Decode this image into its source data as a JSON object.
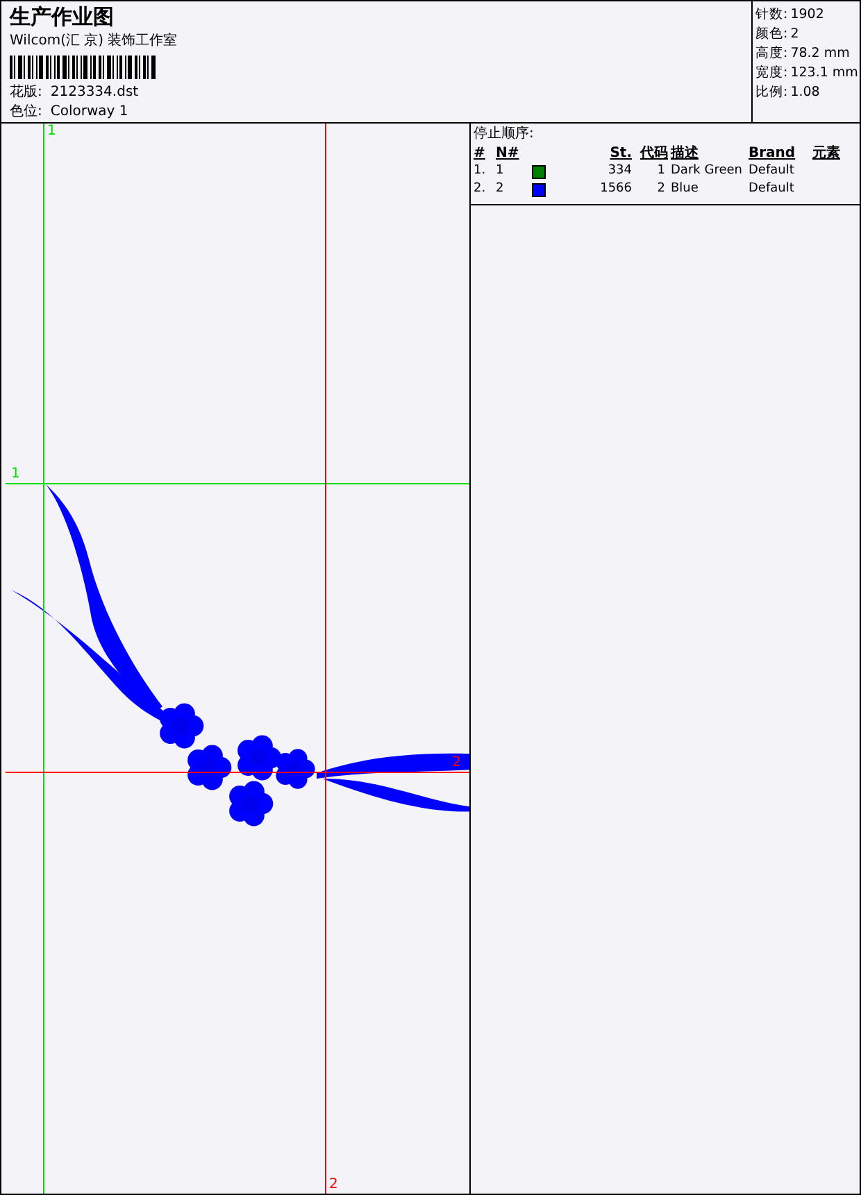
{
  "header": {
    "title": "生产作业图",
    "company": "Wilcom(汇 京) 装饰工作室",
    "fields": [
      {
        "label": "花版:",
        "value": "2123334.dst"
      },
      {
        "label": "色位:",
        "value": "Colorway 1"
      }
    ]
  },
  "stats": [
    {
      "label": "针数:",
      "value": "1902"
    },
    {
      "label": "颜色:",
      "value": "2"
    },
    {
      "label": "高度:",
      "value": "78.2 mm"
    },
    {
      "label": "宽度:",
      "value": "123.1 mm"
    },
    {
      "label": "比例:",
      "value": "1.08"
    }
  ],
  "stop_sequence": {
    "title": "停止顺序:",
    "columns": [
      "#",
      "N#",
      "St.",
      "代码",
      "描述",
      "Brand",
      "元素"
    ],
    "rows": [
      {
        "index": "1.",
        "n": "1",
        "color": "#008000",
        "stitches": "334",
        "code": "1",
        "description": "Dark Green",
        "brand": "Default"
      },
      {
        "index": "2.",
        "n": "2",
        "color": "#0000ff",
        "stitches": "1566",
        "code": "2",
        "description": "Blue",
        "brand": "Default"
      }
    ]
  },
  "canvas": {
    "guides": [
      {
        "kind": "vertical",
        "label": "1",
        "color": "#00dd00"
      },
      {
        "kind": "horizontal",
        "label": "1",
        "color": "#00dd00"
      },
      {
        "kind": "vertical",
        "label": "2",
        "color": "#ff0000"
      },
      {
        "kind": "horizontal",
        "label": "2",
        "color": "#ff0000"
      }
    ]
  }
}
